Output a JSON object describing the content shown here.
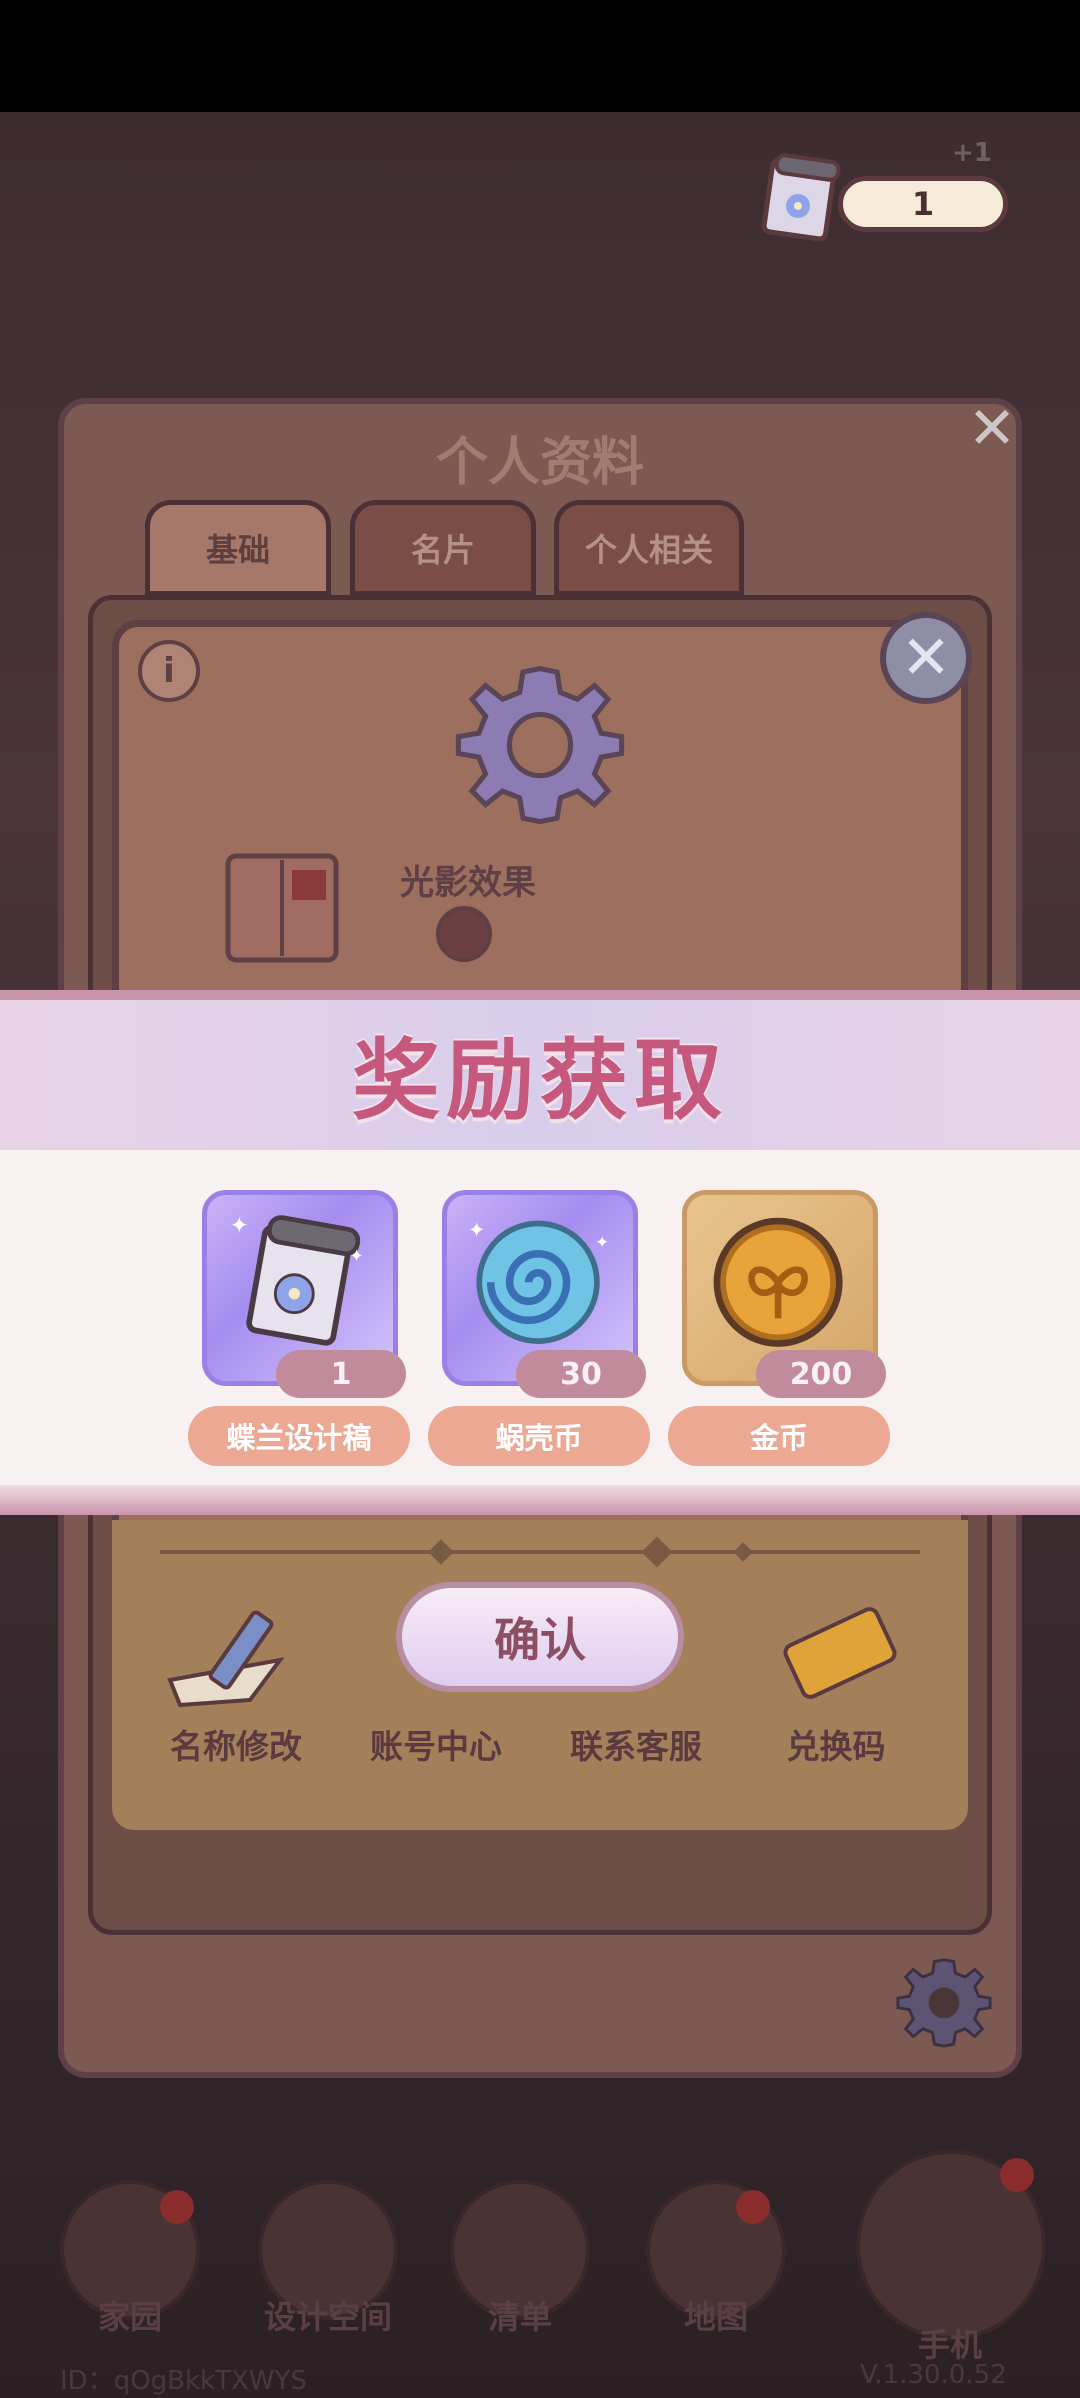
{
  "header": {
    "currency_count": "1",
    "plus_hint": "+1"
  },
  "profile": {
    "title": "个人资料",
    "tabs": [
      {
        "label": "基础"
      },
      {
        "label": "名片"
      },
      {
        "label": "个人相关"
      }
    ]
  },
  "settings": {
    "light_effect_label": "光影效果",
    "actions": [
      {
        "label": "名称修改"
      },
      {
        "label": "账号中心"
      },
      {
        "label": "联系客服"
      },
      {
        "label": "兑换码"
      }
    ]
  },
  "reward": {
    "title": "奖励获取",
    "items": [
      {
        "name": "蝶兰设计稿",
        "count": "1",
        "icon": "orchid-scroll-icon"
      },
      {
        "name": "蜗壳币",
        "count": "30",
        "icon": "snail-coin-icon"
      },
      {
        "name": "金币",
        "count": "200",
        "icon": "gold-coin-icon"
      }
    ],
    "confirm_label": "确认"
  },
  "nav": {
    "items": [
      {
        "label": "家园"
      },
      {
        "label": "设计空间"
      },
      {
        "label": "清单"
      },
      {
        "label": "地图"
      },
      {
        "label": "手机"
      }
    ]
  },
  "footer": {
    "id_text": "ID：qOgBkkTXWYS",
    "version_text": "V.1.30.0.52"
  },
  "colors": {
    "accent": "#c6587e",
    "pill": "#eba994",
    "badge": "#c28b9c"
  }
}
